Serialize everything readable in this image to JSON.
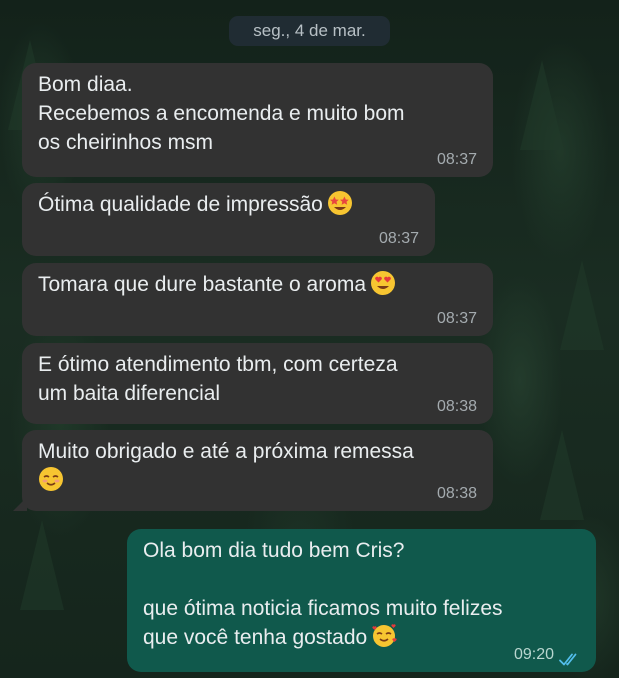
{
  "date_separator": "seg., 4 de mar.",
  "messages": [
    {
      "direction": "incoming",
      "text": "Bom diaa.\nRecebemos a encomenda e muito bom\nos cheirinhos msm",
      "time": "08:37"
    },
    {
      "direction": "incoming",
      "text": "Ótima qualidade de impressão",
      "emoji": "star-struck-emoji",
      "time": "08:37"
    },
    {
      "direction": "incoming",
      "text": "Tomara que dure bastante o aroma",
      "emoji": "heart-eyes-emoji",
      "time": "08:37"
    },
    {
      "direction": "incoming",
      "text": "E ótimo atendimento tbm, com certeza\num baita diferencial",
      "time": "08:38"
    },
    {
      "direction": "incoming",
      "text": "Muito obrigado e até a próxima remessa",
      "emoji": "smiling-blush-emoji",
      "time": "08:38"
    },
    {
      "direction": "outgoing",
      "text": "Ola bom dia tudo bem Cris?\n\nque ótima noticia ficamos muito felizes\nque você tenha gostado",
      "emoji": "smiling-hearts-emoji",
      "time": "09:20",
      "status": "read-double-check"
    }
  ],
  "colors": {
    "incoming_bubble": "#323232",
    "outgoing_bubble": "#10594c",
    "read_ticks": "#53bdeb",
    "text": "#e9edef"
  }
}
